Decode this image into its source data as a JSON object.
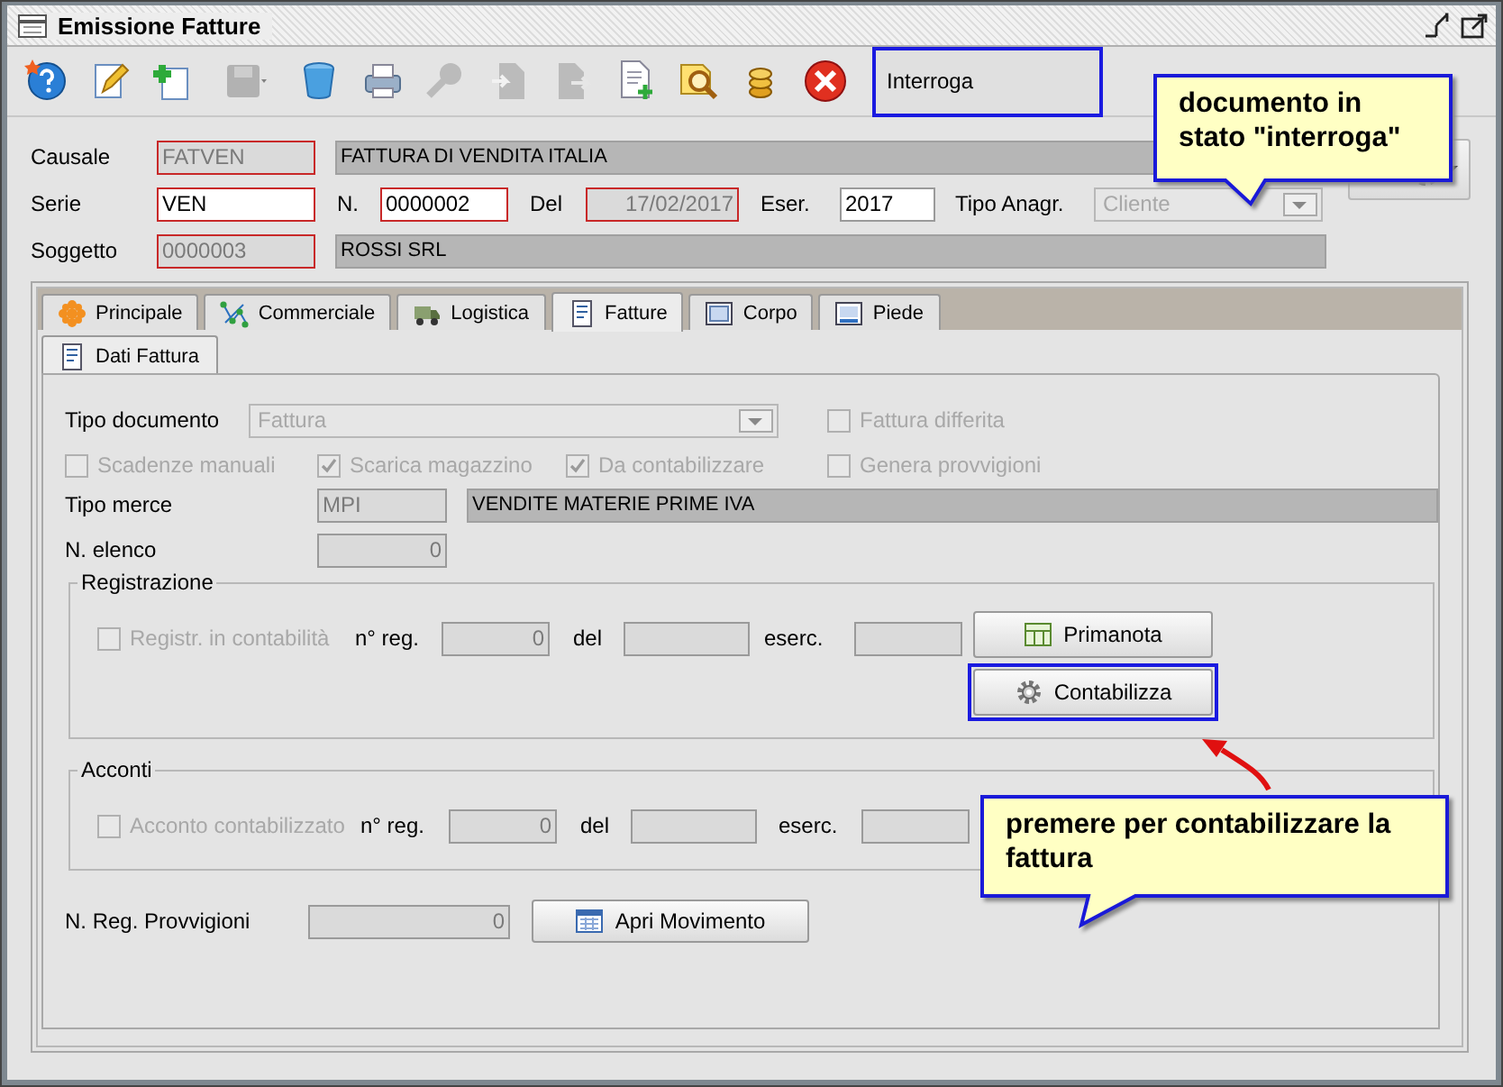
{
  "window": {
    "title": "Emissione Fatture"
  },
  "toolbar": {
    "buttons": [
      {
        "kind": "help",
        "disabled": false
      },
      {
        "kind": "edit",
        "disabled": false
      },
      {
        "kind": "new",
        "disabled": false
      },
      {
        "kind": "save",
        "disabled": true
      },
      {
        "kind": "delete",
        "disabled": false
      },
      {
        "kind": "print",
        "disabled": false
      },
      {
        "kind": "key",
        "disabled": true
      },
      {
        "kind": "import",
        "disabled": true
      },
      {
        "kind": "export",
        "disabled": true
      },
      {
        "kind": "add-doc",
        "disabled": false
      },
      {
        "kind": "search-doc",
        "disabled": false
      },
      {
        "kind": "coins",
        "disabled": false
      },
      {
        "kind": "close",
        "disabled": false
      }
    ],
    "mode": {
      "value": "Interroga",
      "highlighted": true
    }
  },
  "header": {
    "causale": {
      "label": "Causale",
      "value": "FATVEN",
      "readonly": true,
      "required": true,
      "description": "FATTURA DI VENDITA ITALIA"
    },
    "serie": {
      "label": "Serie",
      "value": "VEN",
      "readonly": false,
      "required": true
    },
    "numero": {
      "label": "N.",
      "value": "0000002",
      "readonly": false,
      "required": true
    },
    "data": {
      "label": "Del",
      "value": "17/02/2017",
      "readonly": true,
      "required": true
    },
    "esercizio": {
      "label": "Eser.",
      "value": "2017",
      "readonly": false,
      "required": false
    },
    "tipo_anagrafica": {
      "label": "Tipo Anagr.",
      "value": "Cliente",
      "disabled": true
    },
    "soggetto": {
      "label": "Soggetto",
      "value": "0000003",
      "readonly": true,
      "required": true,
      "description": "ROSSI SRL"
    }
  },
  "tabs": [
    {
      "label": "Principale",
      "kind": "main",
      "selected": false
    },
    {
      "label": "Commerciale",
      "kind": "network",
      "selected": false
    },
    {
      "label": "Logistica",
      "kind": "truck",
      "selected": false
    },
    {
      "label": "Fatture",
      "kind": "document",
      "selected": true
    },
    {
      "label": "Corpo",
      "kind": "frame",
      "selected": false
    },
    {
      "label": "Piede",
      "kind": "footer",
      "selected": false
    }
  ],
  "subtabs": [
    {
      "label": "Dati Fattura",
      "selected": true
    }
  ],
  "dati_fattura": {
    "tipo_documento": {
      "label": "Tipo documento",
      "value": "Fattura",
      "disabled": true
    },
    "fattura_differita": {
      "label": "Fattura differita",
      "checked": false,
      "disabled": true
    },
    "options": [
      {
        "label": "Scadenze manuali",
        "checked": false,
        "disabled": true
      },
      {
        "label": "Scarica magazzino",
        "checked": true,
        "disabled": true
      },
      {
        "label": "Da contabilizzare",
        "checked": true,
        "disabled": true
      },
      {
        "label": "Genera provvigioni",
        "checked": false,
        "disabled": true
      }
    ],
    "tipo_merce": {
      "label": "Tipo merce",
      "value": "MPI",
      "description": "VENDITE MATERIE PRIME IVA"
    },
    "n_elenco": {
      "label": "N. elenco",
      "value": "0"
    },
    "registrazione": {
      "title": "Registrazione",
      "check": {
        "label": "Registr. in contabilità",
        "checked": false,
        "disabled": true
      },
      "n_reg": {
        "label": "n° reg.",
        "value": "0"
      },
      "del": {
        "label": "del"
      },
      "eserc": {
        "label": "eserc."
      },
      "buttons": [
        {
          "label": "Primanota",
          "kind": "table",
          "highlighted": false
        },
        {
          "label": "Contabilizza",
          "kind": "gear",
          "highlighted": true
        }
      ]
    },
    "acconti": {
      "title": "Acconti",
      "check": {
        "label": "Acconto contabilizzato",
        "checked": false,
        "disabled": true
      },
      "n_reg": {
        "label": "n° reg.",
        "value": "0"
      },
      "del": {
        "label": "del"
      },
      "eserc": {
        "label": "eserc."
      }
    },
    "provvigioni": {
      "label": "N. Reg. Provvigioni",
      "value": "0",
      "button": "Apri Movimento"
    }
  },
  "callouts": [
    {
      "text": "documento in stato \"interroga\""
    },
    {
      "text": "premere per contabilizzare la fattura"
    }
  ]
}
